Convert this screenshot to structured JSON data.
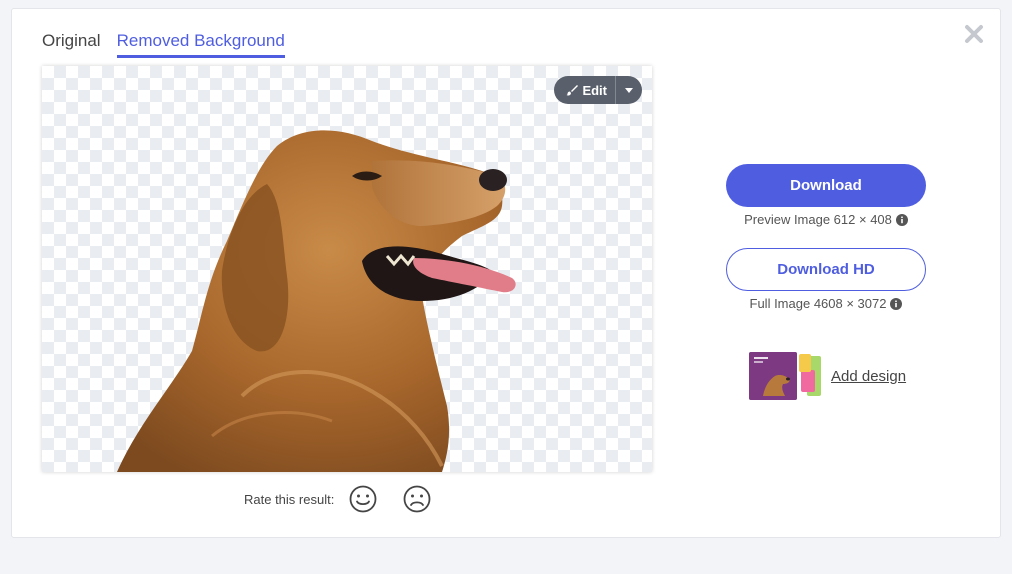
{
  "tabs": [
    {
      "label": "Original",
      "active": false
    },
    {
      "label": "Removed Background",
      "active": true
    }
  ],
  "preview": {
    "edit_label": "Edit"
  },
  "rating": {
    "label": "Rate this result:"
  },
  "download": {
    "label": "Download",
    "caption": "Preview Image 612 × 408"
  },
  "download_hd": {
    "label": "Download HD",
    "caption": "Full Image 4608 × 3072"
  },
  "add_design": {
    "label": "Add design"
  },
  "colors": {
    "accent": "#4f5ee0",
    "edit_button": "#59606b",
    "page_background": "#f3f4f7"
  },
  "icons": [
    "close-icon",
    "brush-icon",
    "caret-down-icon",
    "smile-icon",
    "frown-icon",
    "info-icon"
  ]
}
